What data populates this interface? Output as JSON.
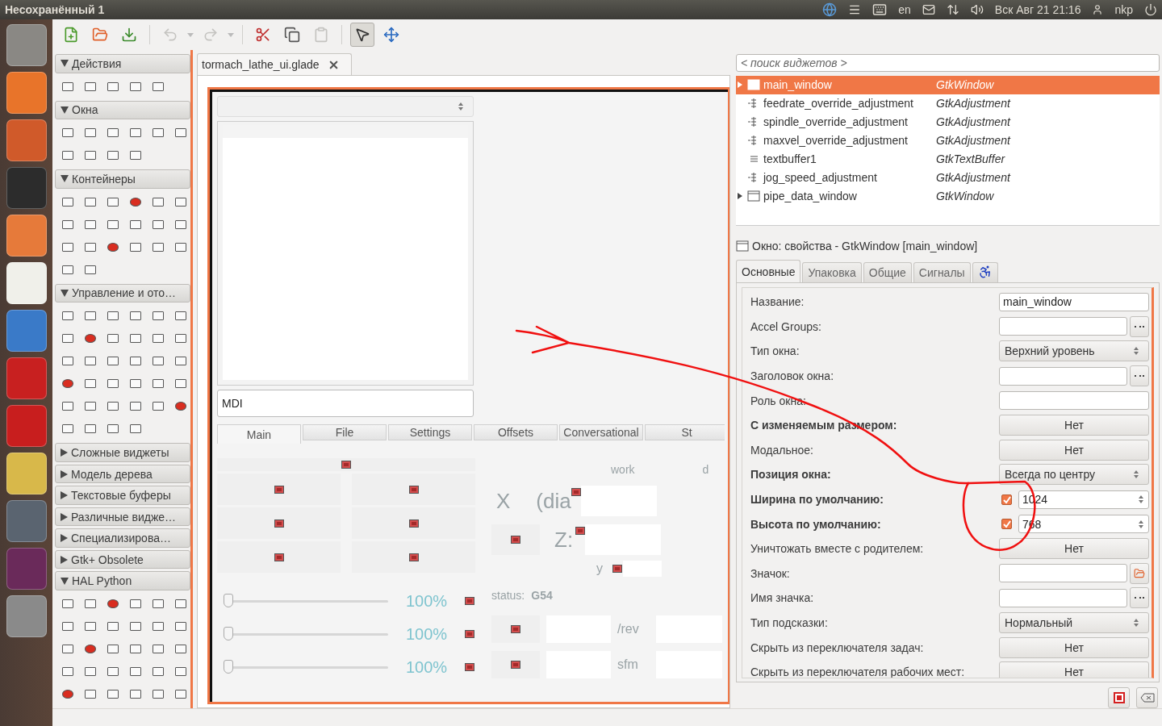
{
  "window": {
    "title": "Несохранённый 1"
  },
  "top_bar": {
    "keyboard_layout": "en",
    "clock": "Вск Авг 21 21:16",
    "user": "nkp"
  },
  "toolbar": {
    "buttons": [
      {
        "kind": "new",
        "disabled": false
      },
      {
        "kind": "open",
        "disabled": false
      },
      {
        "kind": "save",
        "disabled": false
      },
      {
        "kind": "undo",
        "disabled": true
      },
      {
        "kind": "redo",
        "disabled": true
      },
      {
        "kind": "cut",
        "disabled": false
      },
      {
        "kind": "copy",
        "disabled": false
      },
      {
        "kind": "paste",
        "disabled": true
      }
    ],
    "modes": [
      {
        "kind": "select",
        "selected": true
      },
      {
        "kind": "drag",
        "selected": false
      }
    ]
  },
  "palette": {
    "sections": [
      {
        "title": "Действия",
        "expanded": true
      },
      {
        "title": "Окна",
        "expanded": true
      },
      {
        "title": "Контейнеры",
        "expanded": true
      },
      {
        "title": "Управление и ото…",
        "expanded": true
      },
      {
        "title": "Сложные виджеты",
        "expanded": false
      },
      {
        "title": "Модель дерева",
        "expanded": false
      },
      {
        "title": "Текстовые буферы",
        "expanded": false
      },
      {
        "title": "Различные видже…",
        "expanded": false
      },
      {
        "title": "Специализирова…",
        "expanded": false
      },
      {
        "title": "Gtk+ Obsolete",
        "expanded": false
      },
      {
        "title": "HAL Python",
        "expanded": true
      }
    ]
  },
  "document": {
    "tab": "tormach_lathe_ui.glade"
  },
  "design": {
    "mdi_value": "MDI",
    "tabs": [
      {
        "label": "Main",
        "selected": true
      },
      {
        "label": "File",
        "selected": false
      },
      {
        "label": "Settings",
        "selected": false
      },
      {
        "label": "Offsets",
        "selected": false
      },
      {
        "label": "Conversational",
        "selected": false
      },
      {
        "label": "St",
        "selected": false
      }
    ],
    "dro": {
      "work_label": "work",
      "column_2_label": "d",
      "x_label": "X",
      "dia_label": "(dia",
      "z_label": "Z:",
      "y_label": "y",
      "status_label": "status:",
      "status_value": "G54",
      "rev_unit": "/rev",
      "sfm_unit": "sfm"
    },
    "overrides": [
      {
        "level": 0,
        "reading": "100%"
      },
      {
        "level": 0,
        "reading": "100%"
      },
      {
        "level": 0,
        "reading": "100%"
      }
    ]
  },
  "inspector": {
    "search_placeholder": "< поиск виджетов >",
    "rows": [
      {
        "name": "main_window",
        "type": "GtkWindow",
        "kind": "window",
        "expandable": true,
        "selected": true
      },
      {
        "name": "feedrate_override_adjustment",
        "type": "GtkAdjustment",
        "kind": "adjustment",
        "expandable": false,
        "selected": false
      },
      {
        "name": "spindle_override_adjustment",
        "type": "GtkAdjustment",
        "kind": "adjustment",
        "expandable": false,
        "selected": false
      },
      {
        "name": "maxvel_override_adjustment",
        "type": "GtkAdjustment",
        "kind": "adjustment",
        "expandable": false,
        "selected": false
      },
      {
        "name": "textbuffer1",
        "type": "GtkTextBuffer",
        "kind": "textbuffer",
        "expandable": false,
        "selected": false
      },
      {
        "name": "jog_speed_adjustment",
        "type": "GtkAdjustment",
        "kind": "adjustment",
        "expandable": false,
        "selected": false
      },
      {
        "name": "pipe_data_window",
        "type": "GtkWindow",
        "kind": "window",
        "expandable": true,
        "selected": false
      }
    ]
  },
  "properties": {
    "title": "Окно: свойства - GtkWindow [main_window]",
    "tabs": [
      {
        "kind": "text",
        "label": "Основные",
        "selected": true
      },
      {
        "kind": "text",
        "label": "Упаковка",
        "selected": false
      },
      {
        "kind": "text",
        "label": "Общие",
        "selected": false
      },
      {
        "kind": "text",
        "label": "Сигналы",
        "selected": false
      },
      {
        "kind": "accessibility",
        "selected": false
      }
    ],
    "rows": [
      {
        "label": "Название:",
        "bold": false,
        "kind": "entry",
        "value": "main_window"
      },
      {
        "label": "Accel Groups:",
        "bold": false,
        "kind": "entry_dots"
      },
      {
        "label": "Тип окна:",
        "bold": false,
        "kind": "combo",
        "value": "Верхний уровень"
      },
      {
        "label": "Заголовок окна:",
        "bold": false,
        "kind": "entry_dots"
      },
      {
        "label": "Роль окна:",
        "bold": false,
        "kind": "entry"
      },
      {
        "label": "С изменяемым размером:",
        "bold": true,
        "kind": "toggle",
        "value": "Нет"
      },
      {
        "label": "Модальное:",
        "bold": false,
        "kind": "toggle",
        "value": "Нет"
      },
      {
        "label": "Позиция окна:",
        "bold": true,
        "kind": "combo",
        "value": "Всегда по центру"
      },
      {
        "label": "Ширина по умолчанию:",
        "bold": true,
        "kind": "spin",
        "checked": true,
        "value": "1024"
      },
      {
        "label": "Высота по умолчанию:",
        "bold": true,
        "kind": "spin",
        "checked": true,
        "value": "768"
      },
      {
        "label": "Уничтожать вместе с родителем:",
        "bold": false,
        "kind": "toggle",
        "value": "Нет"
      },
      {
        "label": "Значок:",
        "bold": false,
        "kind": "entry_file"
      },
      {
        "label": "Имя значка:",
        "bold": false,
        "kind": "entry_dots"
      },
      {
        "label": "Тип подсказки:",
        "bold": false,
        "kind": "combo",
        "value": "Нормальный"
      },
      {
        "label": "Скрыть из переключателя задач:",
        "bold": false,
        "kind": "toggle",
        "value": "Нет"
      },
      {
        "label": "Скрыть из переключателя рабочих мест:",
        "bold": false,
        "kind": "toggle",
        "value": "Нет"
      }
    ]
  }
}
